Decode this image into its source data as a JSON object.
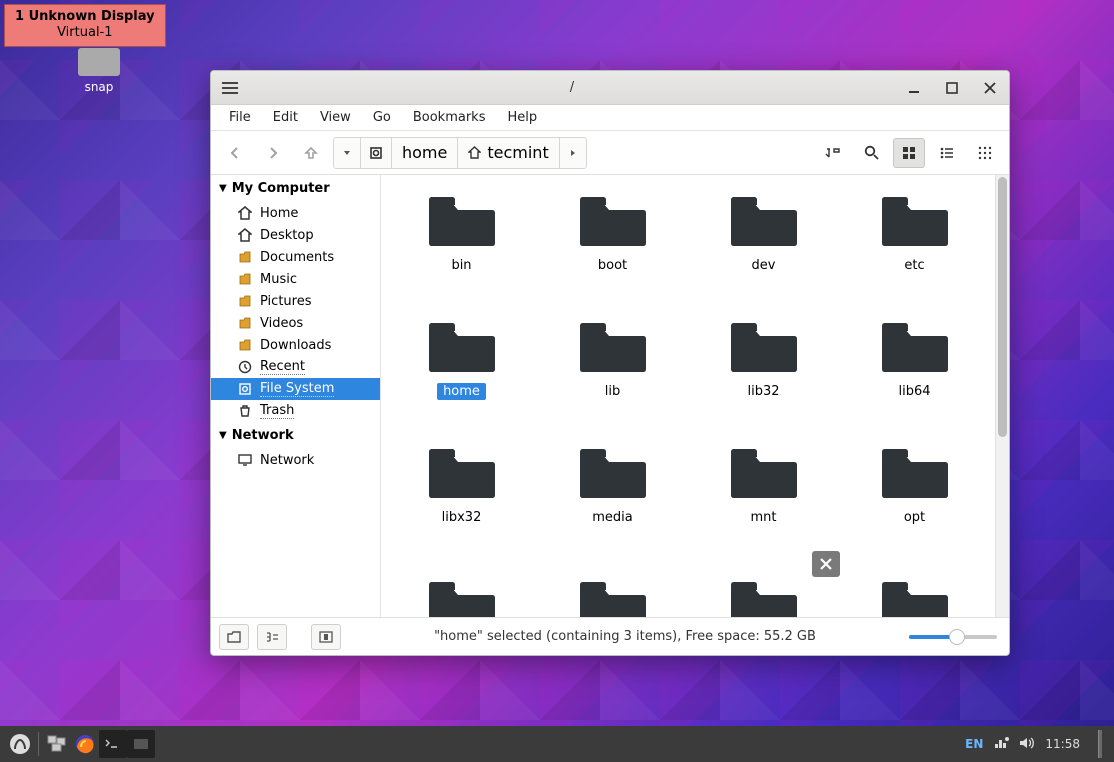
{
  "display_notif": {
    "line1": "1  Unknown Display",
    "line2": "Virtual-1"
  },
  "desktop": {
    "snap_label": "snap"
  },
  "window": {
    "title": "/",
    "menubar": [
      "File",
      "Edit",
      "View",
      "Go",
      "Bookmarks",
      "Help"
    ],
    "path": {
      "seg1": "home",
      "seg2": "tecmint"
    }
  },
  "sidebar": {
    "my_computer_header": "My Computer",
    "items": [
      {
        "label": "Home",
        "icon": "home"
      },
      {
        "label": "Desktop",
        "icon": "home"
      },
      {
        "label": "Documents",
        "icon": "doc"
      },
      {
        "label": "Music",
        "icon": "doc"
      },
      {
        "label": "Pictures",
        "icon": "doc"
      },
      {
        "label": "Videos",
        "icon": "doc"
      },
      {
        "label": "Downloads",
        "icon": "doc"
      },
      {
        "label": "Recent",
        "icon": "clock"
      },
      {
        "label": "File System",
        "icon": "disk",
        "selected": true
      },
      {
        "label": "Trash",
        "icon": "trash"
      }
    ],
    "network_header": "Network",
    "network_items": [
      {
        "label": "Network",
        "icon": "monitor"
      }
    ]
  },
  "folders": [
    {
      "name": "bin"
    },
    {
      "name": "boot"
    },
    {
      "name": "dev"
    },
    {
      "name": "etc"
    },
    {
      "name": "home",
      "selected": true
    },
    {
      "name": "lib"
    },
    {
      "name": "lib32"
    },
    {
      "name": "lib64"
    },
    {
      "name": "libx32"
    },
    {
      "name": "media"
    },
    {
      "name": "mnt"
    },
    {
      "name": "opt"
    },
    {
      "name": ""
    },
    {
      "name": ""
    },
    {
      "name": ""
    },
    {
      "name": ""
    }
  ],
  "status": {
    "text": "\"home\" selected (containing 3 items), Free space: 55.2 GB"
  },
  "taskbar": {
    "lang": "EN",
    "clock": "11:58"
  }
}
